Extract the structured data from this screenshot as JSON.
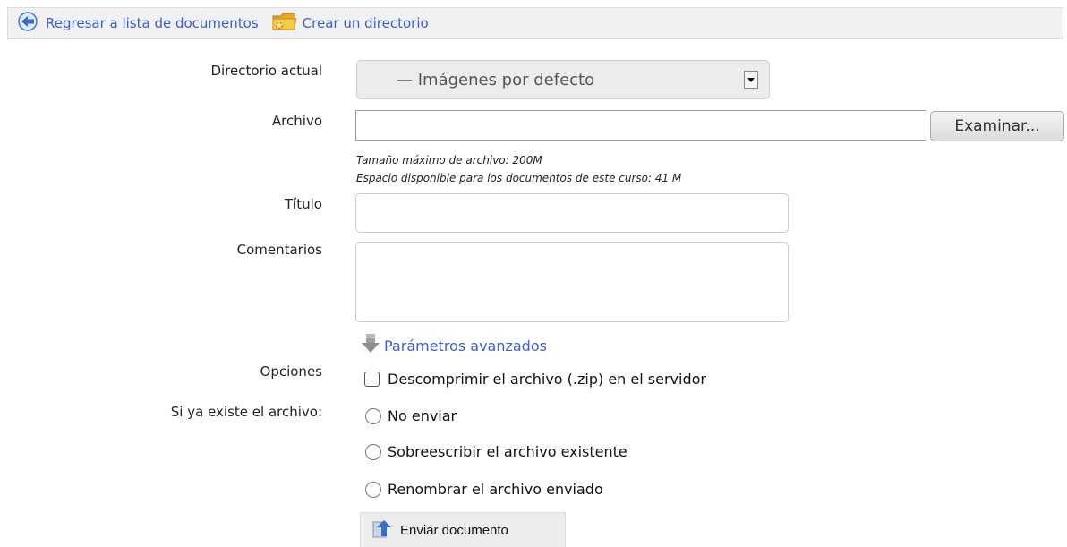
{
  "toolbar": {
    "back_label": "Regresar a lista de documentos",
    "back_icon": "back-arrow-icon",
    "create_dir_label": "Crear un directorio",
    "create_dir_icon": "folder-icon"
  },
  "form": {
    "current_dir": {
      "label": "Directorio actual",
      "selected": "— Imágenes por defecto"
    },
    "file": {
      "label": "Archivo",
      "value": "",
      "browse_label": "Examinar..."
    },
    "hints": {
      "max_size": "Tamaño máximo de archivo: 200M",
      "space": "Espacio disponible para los documentos de este curso: 41 M"
    },
    "title": {
      "label": "Título",
      "value": ""
    },
    "comments": {
      "label": "Comentarios",
      "value": ""
    },
    "advanced_link": "Parámetros avanzados",
    "options": {
      "label": "Opciones",
      "unzip_label": "Descomprimir el archivo (.zip) en el servidor",
      "unzip_checked": false
    },
    "if_exists": {
      "label": "Si ya existe el archivo:",
      "choices": [
        "No enviar",
        "Sobreescribir el archivo existente",
        "Renombrar el archivo enviado"
      ],
      "selected": null
    },
    "submit_label": "Enviar documento"
  },
  "colors": {
    "link": "#3a5dd6",
    "toolbar_bg": "#f1f1f1",
    "select_bg": "#ececec"
  }
}
